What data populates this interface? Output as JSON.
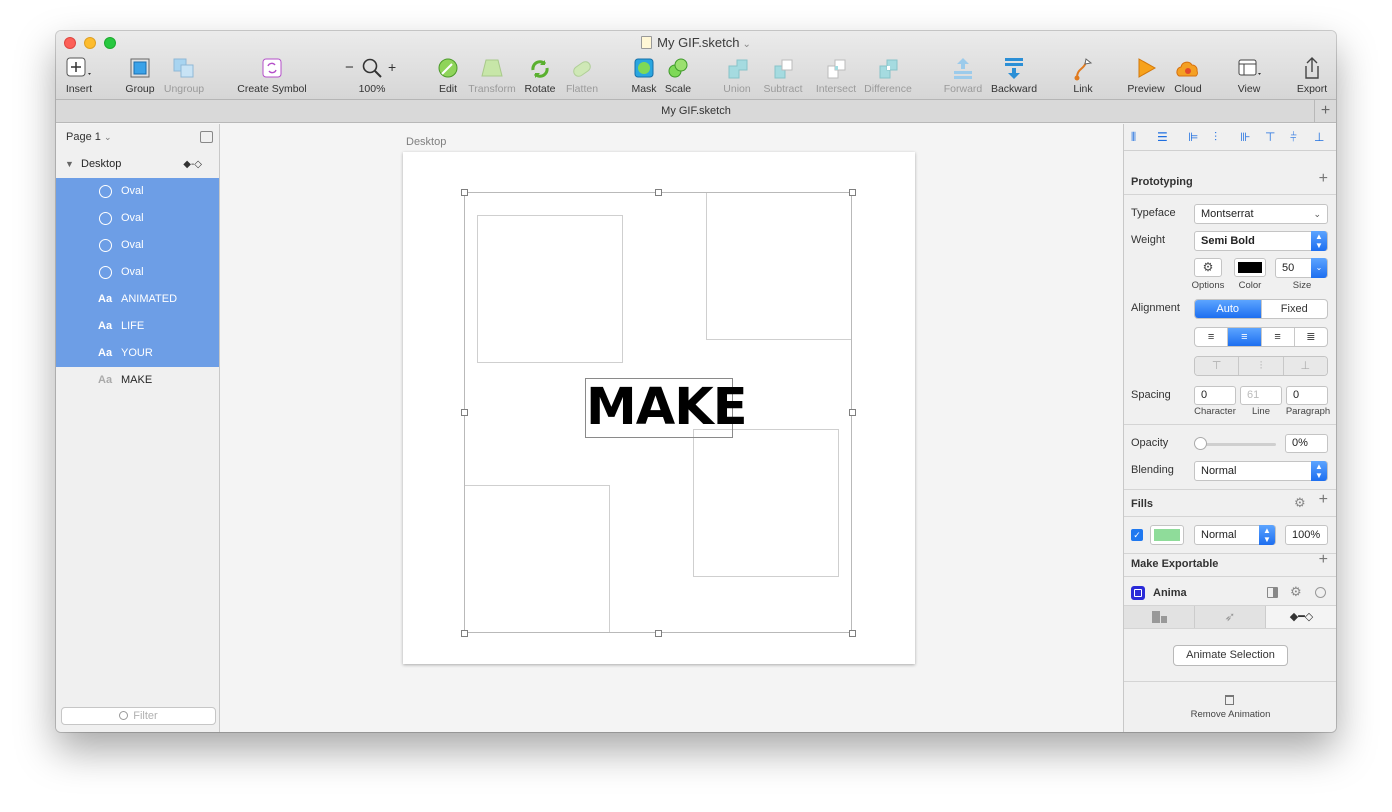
{
  "window": {
    "title": "My GIF.sketch",
    "tab_title": "My GIF.sketch"
  },
  "toolbar": [
    {
      "id": "insert",
      "label": "Insert",
      "icon": "plus-square-icon"
    },
    {
      "id": "group",
      "label": "Group",
      "icon": "group-icon"
    },
    {
      "id": "ungroup",
      "label": "Ungroup",
      "icon": "ungroup-icon"
    },
    {
      "id": "create-symbol",
      "label": "Create Symbol",
      "icon": "symbol-icon"
    },
    {
      "id": "zoom",
      "label": "100%",
      "icon": "magnifier-icon"
    },
    {
      "id": "edit",
      "label": "Edit",
      "icon": "edit-icon"
    },
    {
      "id": "transform",
      "label": "Transform",
      "icon": "transform-icon"
    },
    {
      "id": "rotate",
      "label": "Rotate",
      "icon": "rotate-icon"
    },
    {
      "id": "flatten",
      "label": "Flatten",
      "icon": "flatten-icon"
    },
    {
      "id": "mask",
      "label": "Mask",
      "icon": "mask-icon"
    },
    {
      "id": "scale",
      "label": "Scale",
      "icon": "scale-icon"
    },
    {
      "id": "union",
      "label": "Union",
      "icon": "union-icon"
    },
    {
      "id": "subtract",
      "label": "Subtract",
      "icon": "subtract-icon"
    },
    {
      "id": "intersect",
      "label": "Intersect",
      "icon": "intersect-icon"
    },
    {
      "id": "difference",
      "label": "Difference",
      "icon": "difference-icon"
    },
    {
      "id": "forward",
      "label": "Forward",
      "icon": "forward-icon"
    },
    {
      "id": "backward",
      "label": "Backward",
      "icon": "backward-icon"
    },
    {
      "id": "link",
      "label": "Link",
      "icon": "link-icon"
    },
    {
      "id": "preview",
      "label": "Preview",
      "icon": "play-icon"
    },
    {
      "id": "cloud",
      "label": "Cloud",
      "icon": "cloud-icon"
    },
    {
      "id": "view",
      "label": "View",
      "icon": "view-icon"
    },
    {
      "id": "export",
      "label": "Export",
      "icon": "export-icon"
    }
  ],
  "zoom_minus": "−",
  "zoom_plus": "+",
  "pages": {
    "current": "Page 1"
  },
  "layers": {
    "group_name": "Desktop",
    "items": [
      {
        "icon": "oval-icon",
        "name": "Oval",
        "selected": true
      },
      {
        "icon": "oval-icon",
        "name": "Oval",
        "selected": true
      },
      {
        "icon": "oval-icon",
        "name": "Oval",
        "selected": true
      },
      {
        "icon": "oval-icon",
        "name": "Oval",
        "selected": true
      },
      {
        "icon": "Aa",
        "name": "ANIMATED",
        "selected": true
      },
      {
        "icon": "Aa",
        "name": "LIFE",
        "selected": true
      },
      {
        "icon": "Aa",
        "name": "YOUR",
        "selected": true
      },
      {
        "icon": "Aa",
        "name": "MAKE",
        "selected": false
      }
    ],
    "filter_placeholder": "Filter"
  },
  "canvas": {
    "artboard_label": "Desktop",
    "text": "MAKE"
  },
  "inspector": {
    "prototyping": "Prototyping",
    "typeface_label": "Typeface",
    "typeface": "Montserrat",
    "weight_label": "Weight",
    "weight": "Semi Bold",
    "options_label": "Options",
    "color_label": "Color",
    "size_label": "Size",
    "size": "50",
    "text_color": "#000000",
    "alignment_label": "Alignment",
    "alignment_modes": [
      "Auto",
      "Fixed"
    ],
    "spacing_label": "Spacing",
    "character": "0",
    "line": "61",
    "paragraph": "0",
    "character_label": "Character",
    "line_label": "Line",
    "paragraph_label": "Paragraph",
    "opacity_label": "Opacity",
    "opacity": "0%",
    "blending_label": "Blending",
    "blending": "Normal",
    "fills": "Fills",
    "fill_blend": "Normal",
    "fill_opacity": "100%",
    "fill_color": "#8fdc9a",
    "make_exportable": "Make Exportable",
    "anima": "Anima",
    "animate_selection": "Animate Selection",
    "remove_animation": "Remove Animation"
  }
}
